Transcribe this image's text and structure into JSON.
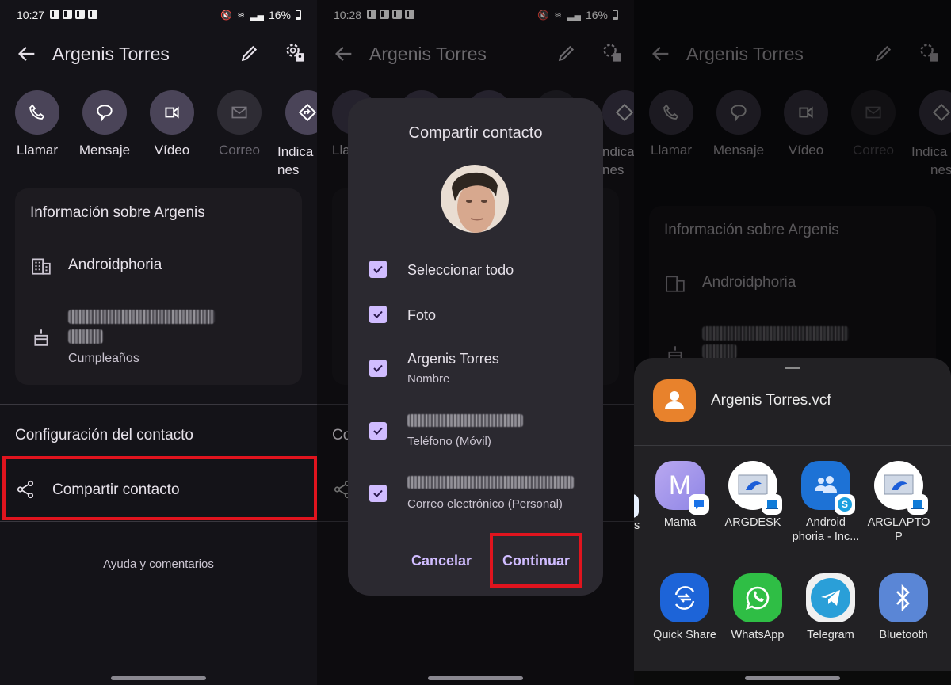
{
  "panels": [
    {
      "status": {
        "time": "10:27",
        "battery": "16%"
      },
      "appbar": {
        "title": "Argenis Torres"
      },
      "actions": [
        {
          "label": "Llamar",
          "icon": "phone-icon",
          "enabled": true
        },
        {
          "label": "Mensaje",
          "icon": "message-icon",
          "enabled": true
        },
        {
          "label": "Vídeo",
          "icon": "video-icon",
          "enabled": true
        },
        {
          "label": "Correo",
          "icon": "mail-icon",
          "enabled": false
        },
        {
          "label": "Indicacio nes",
          "icon": "directions-icon",
          "enabled": true
        }
      ],
      "info_card": {
        "title": "Información sobre Argenis",
        "company": "Androidphoria",
        "birthday_label": "Cumpleaños"
      },
      "settings_section": {
        "title": "Configuración del contacto",
        "share_label": "Compartir contacto"
      },
      "help_link": "Ayuda y comentarios"
    },
    {
      "status": {
        "time": "10:28",
        "battery": "16%"
      },
      "appbar": {
        "title": "Argenis Torres"
      },
      "partial_labels": {
        "left": "Lla",
        "right": "ndica",
        "right2": "nes",
        "section": "Co"
      },
      "dialog": {
        "title": "Compartir contacto",
        "items": [
          {
            "label": "Seleccionar todo",
            "sub": "",
            "checked": true,
            "redacted": false
          },
          {
            "label": "Foto",
            "sub": "",
            "checked": true,
            "redacted": false
          },
          {
            "label": "Argenis Torres",
            "sub": "Nombre",
            "checked": true,
            "redacted": false
          },
          {
            "label": "",
            "sub": "Teléfono (Móvil)",
            "checked": true,
            "redacted": true
          },
          {
            "label": "",
            "sub": "Correo electrónico (Personal)",
            "checked": true,
            "redacted": true
          }
        ],
        "cancel_label": "Cancelar",
        "continue_label": "Continuar"
      }
    },
    {
      "appbar": {
        "title": "Argenis Torres"
      },
      "actions": [
        "Llamar",
        "Mensaje",
        "Vídeo",
        "Correo",
        "Indica"
      ],
      "actions_sub": "nes",
      "info_card": {
        "title": "Información sobre Argenis",
        "company": "Androidphoria"
      },
      "share_sheet": {
        "file_name": "Argenis Torres.vcf",
        "partial_label": "s",
        "contacts": [
          {
            "label": "Mama",
            "icon": "contact-m-icon",
            "badge": "messages-badge-icon"
          },
          {
            "label": "ARGDESK",
            "icon": "pc-icon",
            "badge": "phone-link-badge-icon"
          },
          {
            "label": "Android phoria - Inc...",
            "icon": "group-icon",
            "badge": "skype-badge-icon"
          },
          {
            "label": "ARGLAPTO P",
            "icon": "pc-icon",
            "badge": "phone-link-badge-icon"
          }
        ],
        "apps": [
          {
            "label": "Quick Share",
            "icon": "quick-share-icon"
          },
          {
            "label": "WhatsApp",
            "icon": "whatsapp-icon"
          },
          {
            "label": "Telegram",
            "icon": "telegram-icon"
          },
          {
            "label": "Bluetooth",
            "icon": "bluetooth-icon"
          }
        ]
      }
    }
  ],
  "colors": {
    "background": "#141318",
    "card": "#1d1b20",
    "action_circle": "#4a4458",
    "dialog": "#2b2930",
    "accent": "#d0bcff",
    "highlight": "#e0141e",
    "vcf_icon": "#e8822c"
  }
}
